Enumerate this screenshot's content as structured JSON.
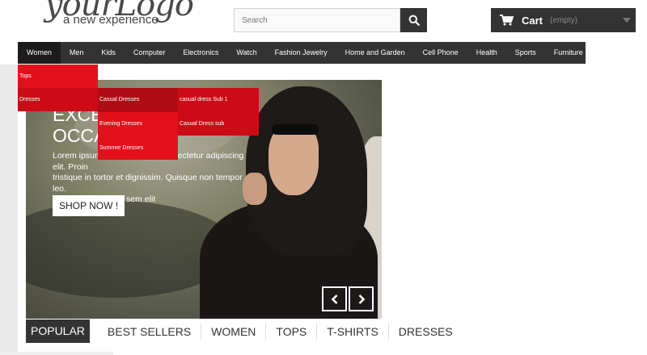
{
  "header": {
    "logo_main": "yourLogo",
    "logo_sub": "a new experience",
    "search_placeholder": "Search",
    "cart_label": "Cart",
    "cart_status": "(empty)"
  },
  "nav": {
    "items": [
      "Women",
      "Men",
      "Kids",
      "Computer",
      "Electronics",
      "Watch",
      "Fashion Jewelry",
      "Home and Garden",
      "Cell Phone",
      "Health",
      "Sports",
      "Furniture"
    ]
  },
  "dropdown": {
    "level1": [
      "Tops",
      "Dresses"
    ],
    "level2": [
      "Casual Dresses",
      "Evening Dresses",
      "Summer Dresses"
    ],
    "level3": [
      "casual dress Sub 1",
      "Casual Dress sub"
    ]
  },
  "hero": {
    "title_line1": "EXCE",
    "title_line2": "OCCA",
    "text_line1": "Lorem ipsum dolor sit amet, consectetur adipiscing elit. Proin",
    "text_line2": "tristique in tortor et dignissim. Quisque non tempor leo.",
    "text_line3": "Maecenas egestas sem elit",
    "button": "SHOP NOW !"
  },
  "tabs": [
    "POPULAR",
    "BEST SELLERS",
    "WOMEN",
    "TOPS",
    "T-SHIRTS",
    "DRESSES"
  ],
  "colors": {
    "menu_red": "#e3101c",
    "dark": "#333333"
  }
}
